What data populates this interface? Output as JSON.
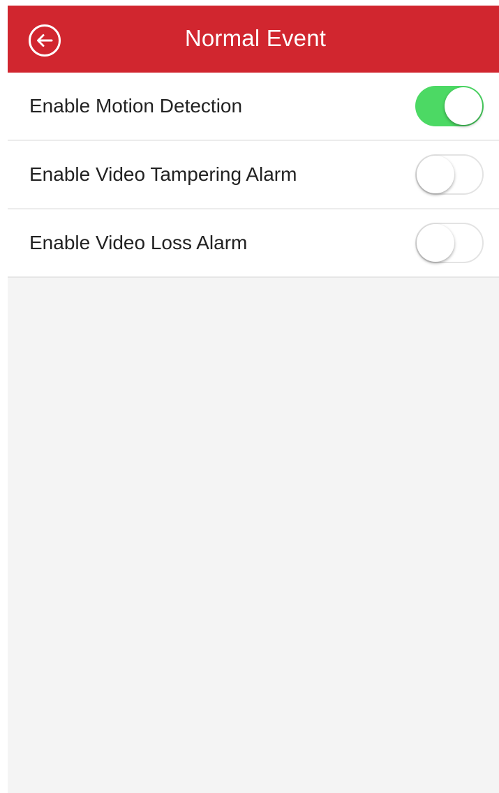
{
  "header": {
    "title": "Normal Event",
    "background_color": "#d1262f",
    "back_icon": "back-arrow-circle-icon"
  },
  "settings": [
    {
      "label": "Enable Motion Detection",
      "enabled": true
    },
    {
      "label": "Enable Video Tampering Alarm",
      "enabled": false
    },
    {
      "label": "Enable Video Loss Alarm",
      "enabled": false
    }
  ],
  "colors": {
    "toggle_on": "#4cd964",
    "page_background": "#f4f4f4"
  }
}
